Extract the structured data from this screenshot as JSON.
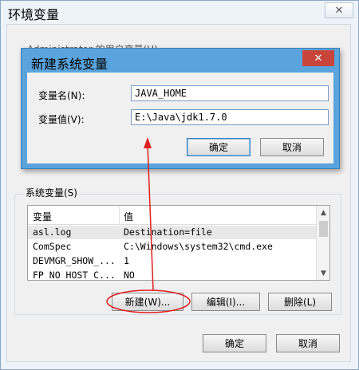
{
  "outer": {
    "title": "环境变量",
    "close_glyph": "✕",
    "user_group_label": "Administrator 的用户变量(U)",
    "ok_label": "确定",
    "cancel_label": "取消"
  },
  "dialog": {
    "title": "新建系统变量",
    "close_glyph": "✕",
    "name_label": "变量名(N):",
    "value_label": "变量值(V):",
    "name_value": "JAVA_HOME",
    "value_value": "E:\\Java\\jdk1.7.0",
    "ok_label": "确定",
    "cancel_label": "取消"
  },
  "system_vars": {
    "group_label": "系统变量(S)",
    "columns": [
      "变量",
      "值"
    ],
    "rows": [
      {
        "name": "asl.log",
        "value": "Destination=file"
      },
      {
        "name": "ComSpec",
        "value": "C:\\Windows\\system32\\cmd.exe"
      },
      {
        "name": "DEVMGR_SHOW_...",
        "value": "1"
      },
      {
        "name": "FP_NO_HOST_C...",
        "value": "NO"
      }
    ],
    "new_label": "新建(W)...",
    "edit_label": "编辑(I)...",
    "delete_label": "删除(L)"
  },
  "colors": {
    "dialog_frame": "#5aa3dc",
    "annotation_red": "#e02020"
  }
}
